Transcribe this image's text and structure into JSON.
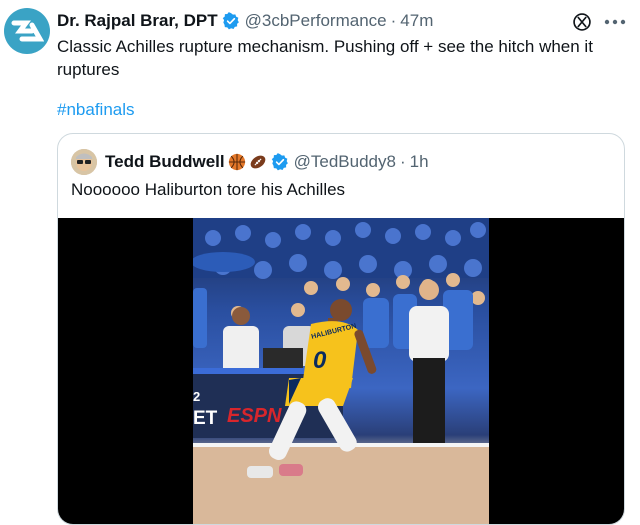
{
  "tweet": {
    "author_name": "Dr. Rajpal Brar, DPT",
    "handle": "@3cbPerformance",
    "separator": "·",
    "time": "47m",
    "text": "Classic Achilles rupture mechanism. Pushing off + see the hitch when it ruptures",
    "hashtag": "#nbafinals"
  },
  "quote": {
    "author_name": "Tedd Buddwell",
    "handle": "@TedBuddy8",
    "separator": "·",
    "time": "1h",
    "text": "Noooooo Haliburton tore his Achilles"
  },
  "video": {
    "scoreboard_left": "2",
    "scoreboard_bottom": "ET",
    "network_logo": "ESPN",
    "jersey_number": "0",
    "jersey_name": "HALIBURTON"
  },
  "colors": {
    "accent": "#1d9bf0",
    "verified": "#1d9bf0",
    "pacers_yellow": "#f6c21c",
    "pacers_navy": "#0b2a5e"
  },
  "icons": [
    "x-logo-icon",
    "more-icon",
    "verified-icon",
    "basketball-emoji-icon",
    "football-emoji-icon"
  ]
}
